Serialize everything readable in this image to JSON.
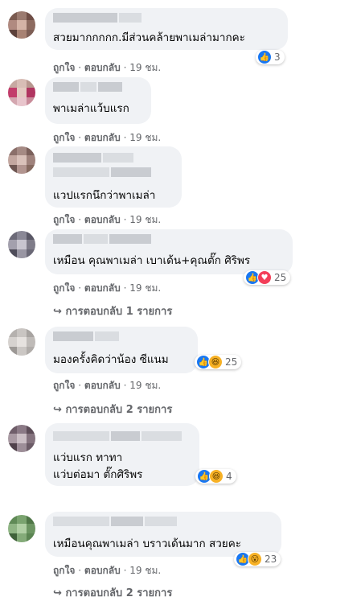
{
  "actions": {
    "like": "ถูกใจ",
    "dot": "·",
    "reply": "ตอบกลับ",
    "time": "19 ชม."
  },
  "comments": [
    {
      "text": "สวยมากกกกก.มีส่วนคล้ายพาเมล่ามากคะ",
      "reactions": {
        "icons": [
          "thumbs-up-icon"
        ],
        "count": "3"
      }
    },
    {
      "text": "พาเมล่าแว้บแรก"
    },
    {
      "text": "แวปแรกนึกว่าพาเมล่า"
    },
    {
      "text": "เหมือน คุณพาเมล่า เบาเด้น+คุณตั๊ก ศิริพร",
      "reactions": {
        "icons": [
          "thumbs-up-icon",
          "heart-icon"
        ],
        "count": "25"
      },
      "replies": "การตอบกลับ 1 รายการ"
    },
    {
      "text": "มองครั้งคิดว่าน้อง ซีแนม",
      "reactions": {
        "icons": [
          "thumbs-up-icon",
          "haha-icon"
        ],
        "count": "25"
      },
      "replies": "การตอบกลับ 2 รายการ"
    },
    {
      "text_lines": [
        "แว่บแรก ทาทา",
        "แว่บต่อมา ตั๊กศิริพร"
      ],
      "reactions": {
        "icons": [
          "thumbs-up-icon",
          "haha-icon"
        ],
        "count": "4"
      }
    },
    {
      "text": "เหมือนคุณพาเมล่า บราวเด้นมาก สวยคะ",
      "reactions": {
        "icons": [
          "thumbs-up-icon",
          "wow-icon"
        ],
        "count": "23"
      },
      "replies": "การตอบกลับ 2 รายการ"
    }
  ],
  "reply_arrow": "↪"
}
